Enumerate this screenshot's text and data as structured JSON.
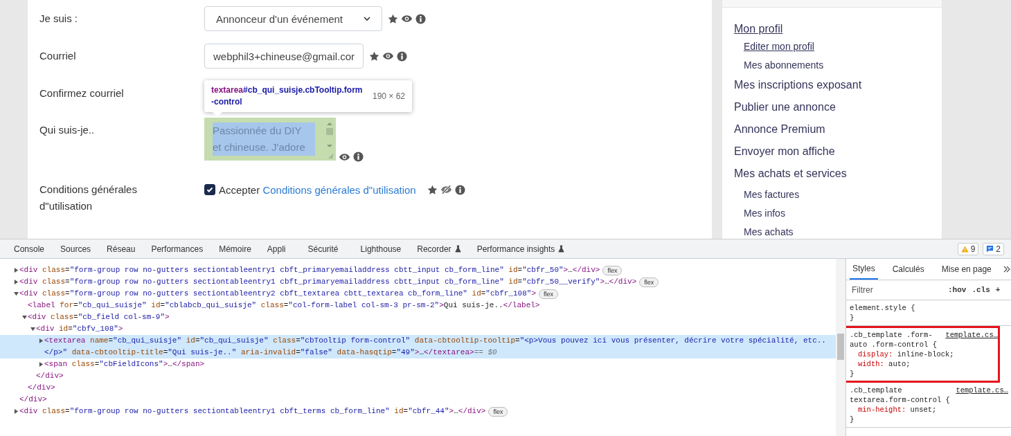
{
  "form": {
    "rows": [
      {
        "kind": "select",
        "label": "Je suis :",
        "value": "Annonceur d'un événement",
        "required": true,
        "public": true
      },
      {
        "kind": "input",
        "label": "Courriel",
        "value": "webphil3+chineuse@gmail.cor",
        "required": true,
        "public": true
      },
      {
        "kind": "covered",
        "label": "Confirmez courriel"
      },
      {
        "kind": "textarea",
        "label": "Qui suis-je..",
        "value": "Passionnée du DIY et chineuse. J'adore",
        "required": false,
        "public": true
      },
      {
        "kind": "checkbox",
        "label": "Conditions générales d\"utilisation",
        "text": "Accepter",
        "link": "Conditions générales d\"utilisation",
        "checked": true,
        "required": true,
        "public": false
      }
    ]
  },
  "inspect_tooltip": {
    "tag": "textarea",
    "selector": "#cb_qui_suisje.cbTooltip.form-control",
    "size": "190 × 62"
  },
  "sidebar": {
    "items": [
      {
        "label": "Mon profil",
        "selected": true,
        "children": [
          {
            "label": "Editer mon profil",
            "selected": true
          },
          {
            "label": "Mes abonnements",
            "selected": false
          }
        ]
      },
      {
        "label": "Mes inscriptions exposant",
        "selected": false
      },
      {
        "label": "Publier une annonce",
        "selected": false
      },
      {
        "label": "Annonce Premium",
        "selected": false
      },
      {
        "label": "Envoyer mon affiche",
        "selected": false
      },
      {
        "label": "Mes achats et services",
        "selected": false,
        "children": [
          {
            "label": "Mes factures",
            "selected": false
          },
          {
            "label": "Mes infos",
            "selected": false
          },
          {
            "label": "Mes achats",
            "selected": false
          }
        ]
      }
    ]
  },
  "devtools": {
    "tabs": [
      {
        "label": "Console",
        "selected": false
      },
      {
        "label": "Sources",
        "selected": false
      },
      {
        "label": "Réseau",
        "selected": false
      },
      {
        "label": "Performances",
        "selected": false
      },
      {
        "label": "Mémoire",
        "selected": false
      },
      {
        "label": "Appli",
        "selected": false
      },
      {
        "label": "Sécurité",
        "selected": false
      },
      {
        "label": "Lighthouse",
        "selected": false
      },
      {
        "label": "Recorder",
        "selected": false,
        "experimental": true
      },
      {
        "label": "Performance insights",
        "selected": false,
        "experimental": true
      }
    ],
    "warnings": "9",
    "messages": "2",
    "dom": [
      {
        "text": "<div class=\"form-group row no-gutters sectiontableentry1 cbft_primaryemailaddress cbtt_input cb_form_line\" id=\"cbfr_50\">…</div>",
        "expanded": false,
        "selected": false,
        "badge": "flex"
      },
      {
        "text": "<div class=\"form-group row no-gutters sectiontableentry1 cbft_primaryemailaddress cbtt_input cb_form_line\" id=\"cbfr_50__verify\">…</div>",
        "expanded": false,
        "selected": false,
        "badge": "flex"
      },
      {
        "text": "<div class=\"form-group row no-gutters sectiontableentry2 cbft_textarea cbtt_textarea cb_form_line\" id=\"cbfr_108\">",
        "expanded": true,
        "selected": false,
        "badge": "flex",
        "close": "</div>",
        "children": [
          {
            "text": "<label for=\"cb_qui_suisje\" id=\"cblabcb_qui_suisje\" class=\"col-form-label col-sm-3 pr-sm-2\">Qui suis-je..</label>",
            "selected": false
          },
          {
            "text": "<div class=\"cb_field col-sm-9\">",
            "expanded": true,
            "selected": false,
            "close": "</div>",
            "children": [
              {
                "text": "<div id=\"cbfv_108\">",
                "expanded": true,
                "selected": false,
                "close": "</div>",
                "children": [
                  {
                    "text": "<textarea name=\"cb_qui_suisje\" id=\"cb_qui_suisje\" class=\"cbTooltip form-control\" data-cbtooltip-tooltip=\"<p>Vous pouvez ici vous présenter, décrire votre spécialité, etc..</p>\" data-cbtooltip-title=\"Qui suis-je..\" aria-invalid=\"false\" data-hasqtip=\"49\">…</textarea>",
                    "expanded": false,
                    "selected": true,
                    "console_ref": "== $0"
                  },
                  {
                    "text": "<span class=\"cbFieldIcons\">…</span>",
                    "expanded": false,
                    "selected": false
                  }
                ]
              }
            ]
          }
        ]
      },
      {
        "text": "<div class=\"form-group row no-gutters sectiontableentry1 cbft_terms cb_form_line\" id=\"cbfr_44\">…</div>",
        "expanded": false,
        "selected": false,
        "badge": "flex"
      }
    ],
    "styles": {
      "tabs": [
        {
          "label": "Styles",
          "selected": true
        },
        {
          "label": "Calculés",
          "selected": false
        },
        {
          "label": "Mise en page",
          "selected": false
        }
      ],
      "filter": {
        "placeholder": "Filtrer"
      },
      "buttons": [
        ":hov",
        ".cls",
        "+"
      ],
      "rules": [
        {
          "selector": "element.style {",
          "close": "}",
          "highlighted": false
        },
        {
          "selector": ".cb_template .form-auto .form-control {",
          "source": "template.cs…",
          "declarations": [
            {
              "property": "display:",
              "value": "inline-block;"
            },
            {
              "property": "width:",
              "value": "auto;"
            }
          ],
          "close": "}",
          "highlighted": true
        },
        {
          "selector": ".cb_template textarea.form-control {",
          "source": "template.cs…",
          "declarations": [
            {
              "property": "min-height:",
              "value": "unset;"
            }
          ],
          "close": "}",
          "highlighted": false
        }
      ]
    }
  }
}
